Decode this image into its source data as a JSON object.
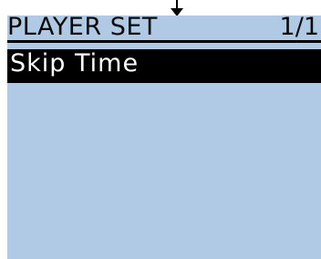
{
  "header": {
    "title": "PLAYER SET",
    "page_indicator": "1/1"
  },
  "menu": {
    "items": [
      {
        "label": "Skip Time",
        "selected": true
      }
    ]
  },
  "colors": {
    "screen_background": "#b0c9e4",
    "selection_background": "#000000",
    "selection_text": "#ffffff",
    "text": "#0a0a0a"
  },
  "icons": {
    "pointer": "down-arrow-icon"
  }
}
